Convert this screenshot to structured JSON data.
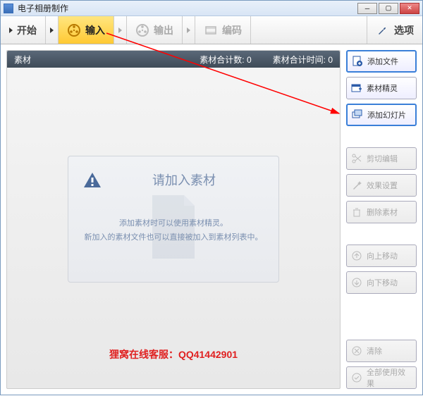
{
  "window": {
    "title": "电子相册制作"
  },
  "toolbar": {
    "start": "开始",
    "input": "输入",
    "output": "输出",
    "encode": "编码",
    "options": "选项"
  },
  "panel": {
    "title": "素材",
    "count_label": "素材合计数:",
    "count_value": "0",
    "time_label": "素材合计时间:",
    "time_value": "0"
  },
  "placeholder": {
    "title": "请加入素材",
    "line1": "添加素材时可以使用素材精灵。",
    "line2": "新加入的素材文件也可以直接被加入到素材列表中。"
  },
  "footer": "狸窝在线客服：QQ41442901",
  "sidebar": {
    "add_file": "添加文件",
    "wizard": "素材精灵",
    "add_slide": "添加幻灯片",
    "clip": "剪切编辑",
    "effect": "效果设置",
    "delete": "删除素材",
    "move_up": "向上移动",
    "move_down": "向下移动",
    "clear": "清除",
    "apply_all": "全部使用效果"
  }
}
